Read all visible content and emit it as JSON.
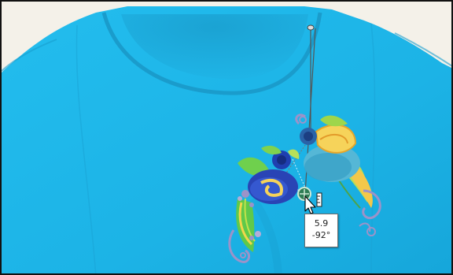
{
  "tooltip": {
    "length": "5.9",
    "angle": "-92°"
  },
  "colors": {
    "background": "#f4f1e9",
    "shirt": "#1fb6e8",
    "selection_line": "#555555",
    "thread_green": "#5fd34a",
    "thread_blue": "#1f3fb0",
    "thread_yellow": "#f6d35a",
    "thread_purple": "#9b93c9",
    "handle": "#2f7d55"
  },
  "icons": {
    "cursor": "mouse-pointer-arrow-icon",
    "handle": "rotation-handle-icon",
    "ruler": "ruler-icon",
    "top_handle": "top-anchor-handle-icon"
  }
}
